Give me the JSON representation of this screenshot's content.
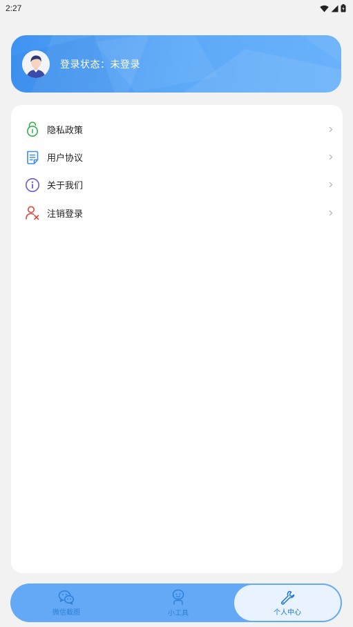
{
  "status_bar": {
    "time": "2:27"
  },
  "profile": {
    "login_status": "登录状态：未登录"
  },
  "menu": {
    "items": [
      {
        "label": "隐私政策",
        "icon": "lock-icon"
      },
      {
        "label": "用户协议",
        "icon": "document-icon"
      },
      {
        "label": "关于我们",
        "icon": "info-icon"
      },
      {
        "label": "注销登录",
        "icon": "user-remove-icon"
      }
    ]
  },
  "tabs": [
    {
      "label": "微信截图",
      "icon": "wechat-icon",
      "active": false
    },
    {
      "label": "小工具",
      "icon": "robot-icon",
      "active": false
    },
    {
      "label": "个人中心",
      "icon": "wrench-icon",
      "active": true
    }
  ],
  "colors": {
    "accent": "#4a9cf3",
    "tab_bar": "#63a9f5",
    "active_tab_bg": "#e9f3ff",
    "privacy_icon": "#2fb34a",
    "agreement_icon": "#3b8de8",
    "about_icon": "#6a5ad6",
    "logout_icon": "#e0453a"
  }
}
